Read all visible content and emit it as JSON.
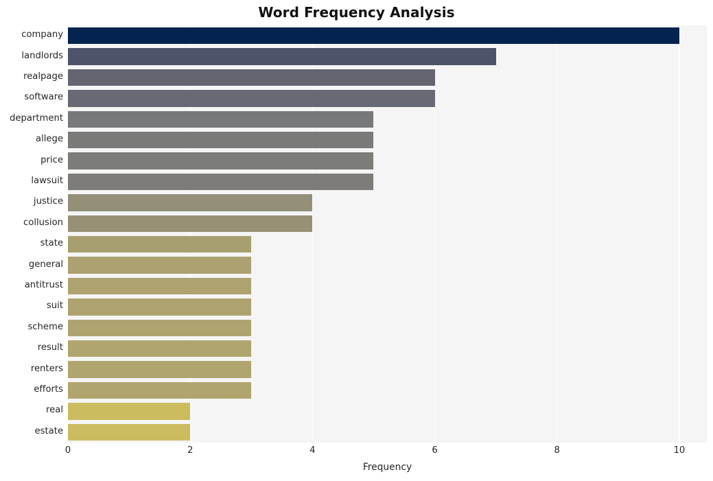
{
  "chart_data": {
    "type": "bar",
    "orientation": "horizontal",
    "title": "Word Frequency Analysis",
    "xlabel": "Frequency",
    "ylabel": "",
    "xlim": [
      0,
      10.45
    ],
    "xticks": [
      0,
      2,
      4,
      6,
      8,
      10
    ],
    "xtick_labels": [
      "0",
      "2",
      "4",
      "6",
      "8",
      "10"
    ],
    "grid": "vertical",
    "legend": "none",
    "background": "#f5f5f5",
    "gridline_color": "#ffffff",
    "categories": [
      "company",
      "landlords",
      "realpage",
      "software",
      "department",
      "allege",
      "price",
      "lawsuit",
      "justice",
      "collusion",
      "state",
      "general",
      "antitrust",
      "suit",
      "scheme",
      "result",
      "renters",
      "efforts",
      "real",
      "estate"
    ],
    "values": [
      10,
      7,
      6,
      6,
      5,
      5,
      5,
      5,
      4,
      4,
      3,
      3,
      3,
      3,
      3,
      3,
      3,
      3,
      2,
      2
    ],
    "bar_colors": [
      "#04244f",
      "#4d5369",
      "#636670",
      "#676a74",
      "#77787a",
      "#7a7a79",
      "#7c7c79",
      "#7d7c79",
      "#938f79",
      "#969175",
      "#a89f71",
      "#aba171",
      "#ada270",
      "#aea36f",
      "#afa46f",
      "#b0a56e",
      "#b0a56e",
      "#b0a56e",
      "#cbbc5f",
      "#cbbc5f"
    ]
  }
}
